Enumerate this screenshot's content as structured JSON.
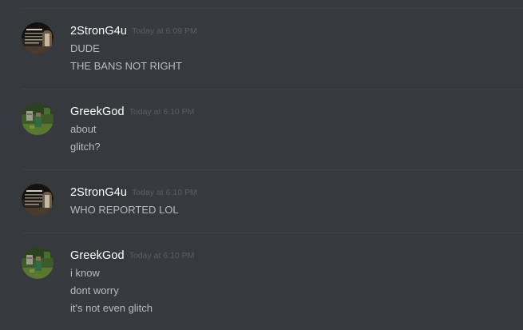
{
  "messages": [
    {
      "author": "2StronG4u",
      "timestamp": "Today at 6:09 PM",
      "avatar_icon": "user-avatar-icon",
      "lines": [
        "DUDE",
        "THE BANS NOT RIGHT"
      ]
    },
    {
      "author": "GreekGod",
      "timestamp": "Today at 6:10 PM",
      "avatar_icon": "user-avatar-icon",
      "lines": [
        "about",
        "glitch?"
      ]
    },
    {
      "author": "2StronG4u",
      "timestamp": "Today at 6:10 PM",
      "avatar_icon": "user-avatar-icon",
      "lines": [
        "WHO REPORTED LOL"
      ]
    },
    {
      "author": "GreekGod",
      "timestamp": "Today at 6:10 PM",
      "avatar_icon": "user-avatar-icon",
      "lines": [
        "i know",
        "dont worry",
        "it's not even glitch"
      ]
    }
  ],
  "colors": {
    "background": "#36393e",
    "username": "#ffffff",
    "message_text": "#b9bbbe",
    "timestamp": "#5b5e63",
    "divider": "#3e4146"
  }
}
